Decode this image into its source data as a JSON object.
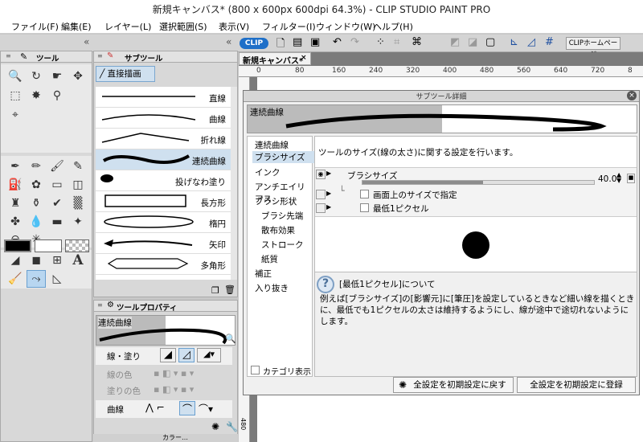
{
  "window": {
    "title": "新規キャンバス* (800 x 600px 600dpi 64.3%) - CLIP STUDIO PAINT PRO"
  },
  "menu": [
    "ファイル(F)",
    "編集(E)",
    "レイヤー(L)",
    "選択範囲(S)",
    "表示(V)",
    "フィルター(I)",
    "ウィンドウ(W)",
    "ヘルプ(H)"
  ],
  "toolbar": {
    "clip_badge": "CLIP",
    "clip_home": "CLIPホームページ"
  },
  "tool_panel": {
    "tab": "ツール"
  },
  "subtool_panel": {
    "tab": "サブツール",
    "group": "直接描画",
    "items": [
      "直線",
      "曲線",
      "折れ線",
      "連続曲線",
      "投げなわ塗り",
      "長方形",
      "楕円",
      "矢印",
      "多角形"
    ],
    "selected": "連続曲線"
  },
  "tool_property": {
    "tab": "ツールプロパティ",
    "name": "連続曲線",
    "rows": [
      "線・塗り",
      "線の色",
      "塗りの色",
      "曲線"
    ]
  },
  "color_panel_tab": "カラー…",
  "document": {
    "tab": "新規キャンバス*",
    "ruler": [
      "0",
      "80",
      "160",
      "240",
      "320",
      "400",
      "480",
      "560",
      "640",
      "720",
      "8"
    ],
    "vruler": "480"
  },
  "dialog": {
    "title": "サブツール詳細",
    "preview_name": "連続曲線",
    "categories": [
      {
        "label": "連続曲線",
        "level": 0
      },
      {
        "label": "ブラシサイズ",
        "level": 0,
        "selected": true
      },
      {
        "label": "インク",
        "level": 0
      },
      {
        "label": "アンチエイリアス",
        "level": 0
      },
      {
        "label": "ブラシ形状",
        "level": 0
      },
      {
        "label": "ブラシ先端",
        "level": 1
      },
      {
        "label": "散布効果",
        "level": 1
      },
      {
        "label": "ストローク",
        "level": 1
      },
      {
        "label": "紙質",
        "level": 1
      },
      {
        "label": "補正",
        "level": 0
      },
      {
        "label": "入り抜き",
        "level": 0
      }
    ],
    "heading": "ツールのサイズ(線の太さ)に関する設定を行います。",
    "brush_size_label": "ブラシサイズ",
    "brush_size_value": "40.0",
    "brush_size_fraction": 0.52,
    "option1": "画面上のサイズで指定",
    "option2": "最低1ピクセル",
    "info_title": "[最低1ピクセル]について",
    "info_text": "例えば[ブラシサイズ]の[影響元]に[筆圧]を設定しているときなど細い線を描くときに、最低でも1ピクセルの太さは維持するようにし、線が途中で途切れないようにします。",
    "category_display": "カテゴリ表示",
    "reset_button": "全設定を初期設定に戻す",
    "register_button": "全設定を初期設定に登録"
  }
}
